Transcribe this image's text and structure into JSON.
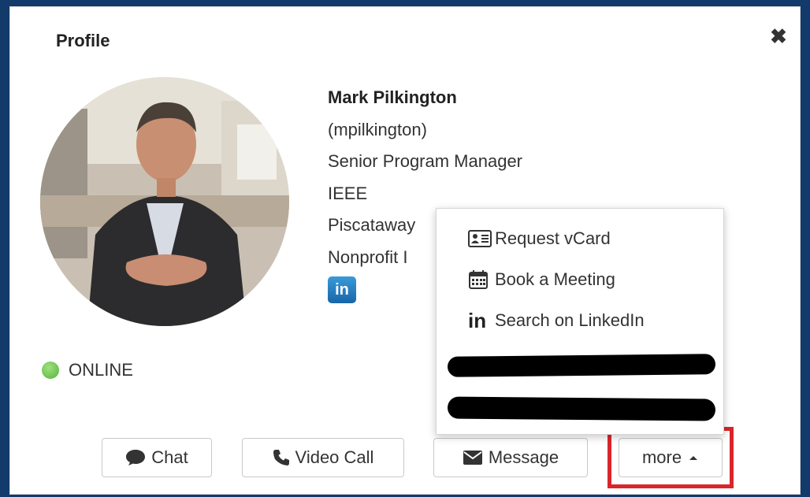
{
  "dialog": {
    "title": "Profile",
    "close_symbol": "✖"
  },
  "profile": {
    "name": "Mark Pilkington",
    "username": "(mpilkington)",
    "job_title": "Senior Program Manager",
    "organization": "IEEE",
    "location_partial": "Piscataway",
    "industry_partial": "Nonprofit I",
    "social_badge": "in",
    "status": "ONLINE",
    "status_color": "#5cb83f"
  },
  "actions": {
    "chat": "Chat",
    "video_call": "Video Call",
    "message": "Message",
    "more": "more"
  },
  "more_menu": {
    "items": [
      {
        "label": "Request vCard",
        "icon": "vcard-icon"
      },
      {
        "label": "Book a Meeting",
        "icon": "calendar-icon"
      },
      {
        "label": "Search on LinkedIn",
        "icon": "linkedin-icon",
        "icon_text": "in"
      }
    ],
    "redacted_items": 2
  },
  "colors": {
    "frame": "#123a6b",
    "highlight": "#d9262b",
    "linkedin": "#1766a8"
  }
}
